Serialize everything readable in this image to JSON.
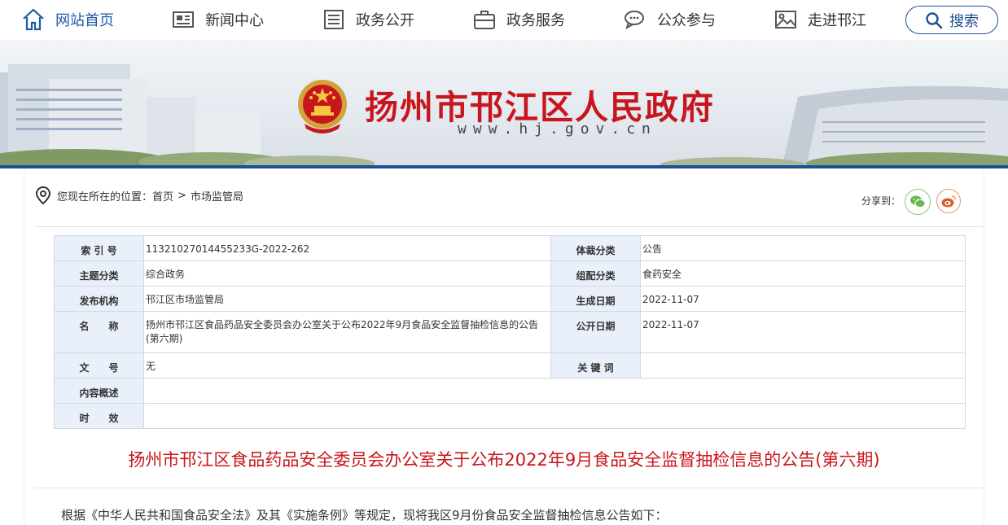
{
  "nav": {
    "items": [
      {
        "label": "网站首页"
      },
      {
        "label": "新闻中心"
      },
      {
        "label": "政务公开"
      },
      {
        "label": "政务服务"
      },
      {
        "label": "公众参与"
      },
      {
        "label": "走进邗江"
      }
    ],
    "search_label": "搜索"
  },
  "banner": {
    "title": "扬州市邗江区人民政府",
    "url": "www.hj.gov.cn"
  },
  "breadcrumb": {
    "prefix": "您现在所在的位置：",
    "items": [
      "首页",
      "市场监管局"
    ],
    "separator": ">"
  },
  "share": {
    "label": "分享到："
  },
  "meta": {
    "rows": [
      {
        "k1": "索 引 号",
        "v1": "11321027014455233G-2022-262",
        "k2": "体裁分类",
        "v2": "公告"
      },
      {
        "k1": "主题分类",
        "v1": "综合政务",
        "k2": "组配分类",
        "v2": "食药安全"
      },
      {
        "k1": "发布机构",
        "v1": "邗江区市场监管局",
        "k2": "生成日期",
        "v2": "2022-11-07"
      },
      {
        "k1": "名　　称",
        "v1": "扬州市邗江区食品药品安全委员会办公室关于公布2022年9月食品安全监督抽检信息的公告(第六期)",
        "k2": "公开日期",
        "v2": "2022-11-07"
      },
      {
        "k1": "文　　号",
        "v1": "无",
        "k2": "关 键 词",
        "v2": ""
      },
      {
        "k1": "内容概述",
        "v1": ""
      },
      {
        "k1": "时　　效",
        "v1": ""
      }
    ]
  },
  "article": {
    "title": "扬州市邗江区食品药品安全委员会办公室关于公布2022年9月食品安全监督抽检信息的公告(第六期)",
    "first_para": "根据《中华人民共和国食品安全法》及其《实施条例》等规定，现将我区9月份食品安全监督抽检信息公告如下："
  },
  "colors": {
    "brand_blue": "#1d4f91",
    "title_red": "#c8161d",
    "table_header_bg": "#e9f0fa"
  }
}
